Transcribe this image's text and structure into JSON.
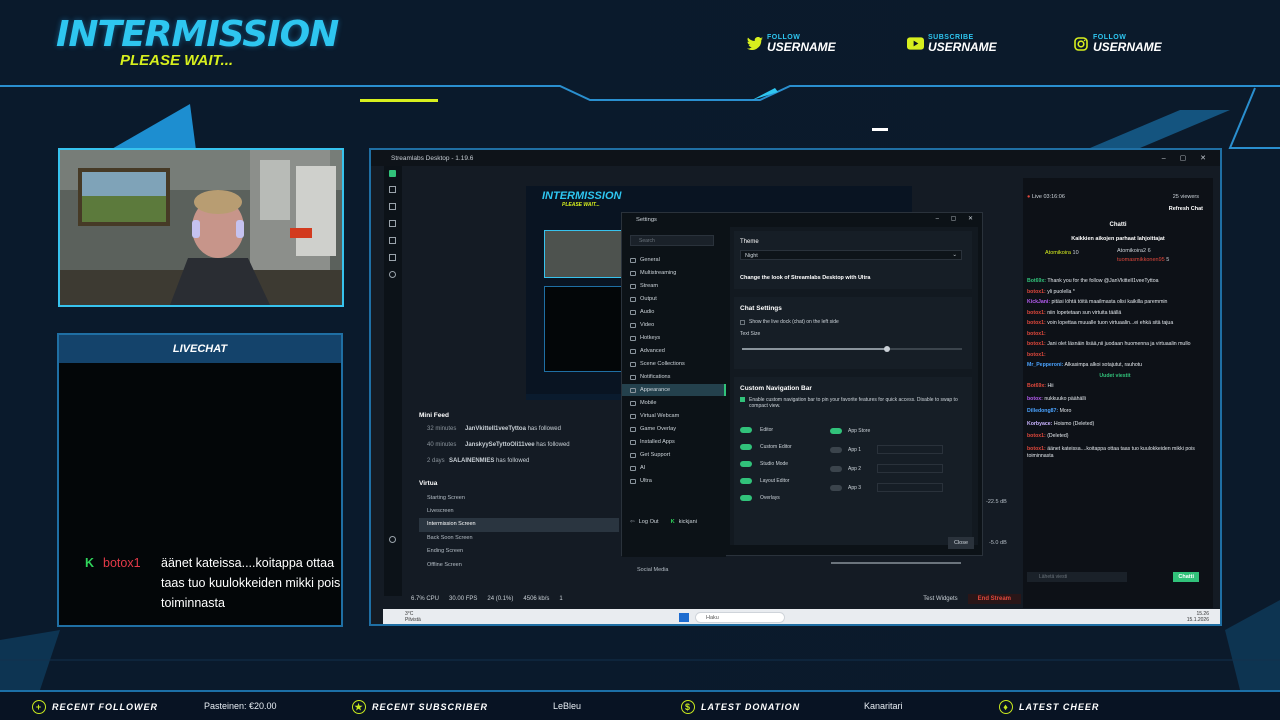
{
  "overlay": {
    "title": "INTERMISSION",
    "subtitle": "PLEASE WAIT...",
    "socials": [
      {
        "icon": "twitter-icon",
        "label": "FOLLOW",
        "user": "USERNAME"
      },
      {
        "icon": "youtube-icon",
        "label": "SUBSCRIBE",
        "user": "USERNAME"
      },
      {
        "icon": "instagram-icon",
        "label": "FOLLOW",
        "user": "USERNAME"
      }
    ],
    "livechat_title": "LIVECHAT",
    "chat": {
      "user": "botox1",
      "message": "äänet kateissa....koitappa ottaa taas tuo kuulokkeiden mikki pois toiminnasta"
    },
    "bottom": {
      "items": [
        {
          "icon": "plus-icon",
          "label": "RECENT FOLLOWER",
          "value": "Pasteinen: €20.00"
        },
        {
          "icon": "star-icon",
          "label": "RECENT SUBSCRIBER",
          "value": "LeBleu"
        },
        {
          "icon": "dollar-icon",
          "label": "LATEST DONATION",
          "value": "Kanaritari"
        },
        {
          "icon": "drop-icon",
          "label": "LATEST CHEER",
          "value": ""
        }
      ]
    },
    "colors": {
      "accent": "#2ec6f0",
      "lime": "#d7ef1e",
      "border": "#1f6fa4"
    }
  },
  "app": {
    "window_title": "Streamlabs Desktop - 1.19.6",
    "preview_title": "INTERMISSION",
    "preview_sub": "PLEASE WAIT...",
    "mini_feed": {
      "title": "Mini Feed",
      "rows": [
        {
          "time": "32 minutes",
          "user": "JanVkittelI1veeTyttoa",
          "action": "has followed"
        },
        {
          "time": "40 minutes",
          "user": "JanskyySeTyttoOli11vee",
          "action": "has followed"
        },
        {
          "time": "2 days",
          "user": "SALAINENMIES",
          "action": "has followed"
        }
      ]
    },
    "scenes": {
      "title": "Virtua",
      "items": [
        "Starting Screen",
        "Livescreen",
        "Intermission Screen",
        "Back Soon Screen",
        "Ending Screen",
        "Offline Screen"
      ],
      "selected": 2
    },
    "sources_bottom": [
      "Social Media"
    ],
    "statusbar": {
      "cpu": "6.7% CPU",
      "fps": "30.00 FPS",
      "dropped": "24 (0.1%)",
      "bitrate": "4506 kb/s",
      "alerts": "1",
      "test_widgets": "Test Widgets",
      "end_stream": "End Stream"
    },
    "settings": {
      "title": "Settings",
      "search_placeholder": "Search",
      "nav": [
        "General",
        "Multistreaming",
        "Stream",
        "Output",
        "Audio",
        "Video",
        "Hotkeys",
        "Advanced",
        "Scene Collections",
        "Notifications",
        "Appearance",
        "Mobile",
        "Virtual Webcam",
        "Game Overlay",
        "Installed Apps",
        "Get Support",
        "AI",
        "Ultra"
      ],
      "selected": 10,
      "logout": "Log Out",
      "account": "kickjani",
      "theme_label": "Theme",
      "theme_value": "Night",
      "ultra_link": "Change the look of Streamlabs Desktop with Ultra",
      "chat_settings": "Chat Settings",
      "chat_left": "Show the live dock (chat) on the left side",
      "text_size": "Text Size",
      "text_size_value": 0.66,
      "custom_nav": "Custom Navigation Bar",
      "custom_nav_desc": "Enable custom navigation bar to pin your favorite features for quick access. Disable to swap to compact view.",
      "nav_toggles": [
        {
          "label": "Editor",
          "on": true
        },
        {
          "label": "Custom Editor",
          "on": true
        },
        {
          "label": "Studio Mode",
          "on": true
        },
        {
          "label": "Layout Editor",
          "on": true
        },
        {
          "label": "Overlays",
          "on": true
        }
      ],
      "app_toggles": [
        {
          "label": "App Store",
          "on": true
        },
        {
          "label": "App 1",
          "on": false
        },
        {
          "label": "App 2",
          "on": false
        },
        {
          "label": "App 3",
          "on": false
        }
      ],
      "close": "Close"
    },
    "mixer": {
      "db1": "-22.5 dB",
      "db2": "-5.0 dB"
    },
    "dock": {
      "live": "Live 03:16:06",
      "viewers": "25 viewers",
      "refresh": "Refresh Chat",
      "chat_title": "Chatti",
      "top_title": "Kaikkien aikojen parhaat lahjoittajat",
      "top1": "Atomikoira",
      "top1_count": "10",
      "top2": "Atomikoira2",
      "top2_count": "6",
      "top3": "tuomasmikkonen95",
      "top3_count": "5",
      "messages": [
        {
          "user": "Bot69x:",
          "text": "Thank you for the follow @JanVkittelI1veeTyttoa"
        },
        {
          "user": "botox1:",
          "text": "yli puolella *"
        },
        {
          "user": "KickJani:",
          "text": "pitäsi löhtä töitä maailmasta olisi kaikilla paremmin"
        },
        {
          "user": "botox1:",
          "text": "niin lopetetaan sun virtuita täällä"
        },
        {
          "user": "botox1:",
          "text": "voin lopettaa muualle tuon virtuaalin...ei ehkä sitä tajua"
        },
        {
          "user": "botox1:",
          "text": ""
        },
        {
          "user": "botox1:",
          "text": "Jani olet läsnäin lisää,nii juodaan huomenna ja virtuaalin mullo"
        },
        {
          "user": "botox1:",
          "text": ""
        },
        {
          "user": "Mr_Pepperoni:",
          "text": "Alkasimpa alkoi sotajutut, rauhotu"
        }
      ],
      "new_messages": "Uudet viestit",
      "messages2": [
        {
          "user": "Bot69x:",
          "text": "Hii"
        },
        {
          "user": "botox:",
          "text": "nukkuuko päähälli"
        },
        {
          "user": "Dilledong87:",
          "text": "Moro"
        },
        {
          "user": "Korbyace:",
          "text": "Hoismo (Deleted)"
        },
        {
          "user": "botox1:",
          "text": "(Deleted)"
        },
        {
          "user": "botox1:",
          "text": "äänet kateissa....koitappa ottaa taas tuo kuulokkeiden mikki pois toiminnasta"
        }
      ],
      "input_placeholder": "Lähetä viesti",
      "send": "Chatti"
    },
    "taskbar": {
      "temp": "3°C",
      "weather": "Pilvistä",
      "search": "Haku",
      "time": "15.26",
      "date": "15.1.2026"
    }
  }
}
